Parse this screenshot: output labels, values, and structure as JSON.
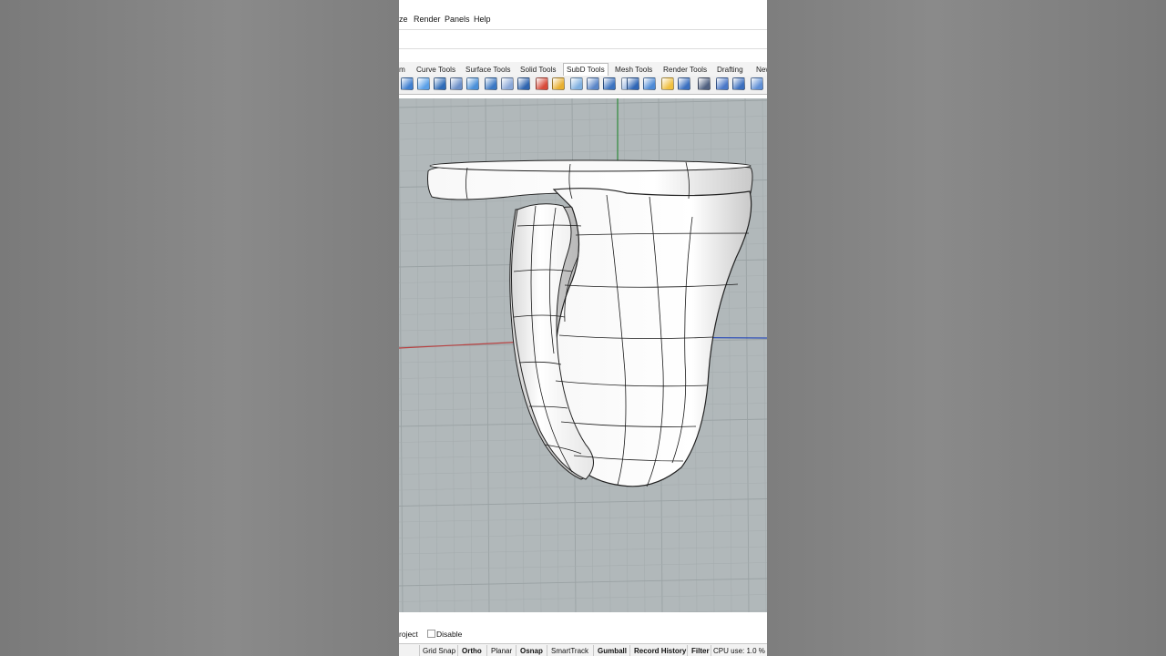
{
  "menu": {
    "items": [
      "ze",
      "Render",
      "Panels",
      "Help"
    ]
  },
  "tabs": [
    "m",
    "Curve Tools",
    "Surface Tools",
    "Solid Tools",
    "SubD Tools",
    "Mesh Tools",
    "Render Tools",
    "Drafting",
    "New"
  ],
  "active_tab": "SubD Tools",
  "toolbar_icons": [
    "subd-box-icon",
    "subd-sphere-icon",
    "subd-cylinder-icon",
    "subd-cone-icon",
    "subd-torus-icon",
    "subd-plane-icon",
    "subd-stretch-icon",
    "subd-bridge-icon",
    "subd-grid-icon",
    "subd-frame-icon",
    "subd-color-icon",
    "subd-crease-icon",
    "subd-weld-icon",
    "subd-fill-icon",
    "subd-star-icon",
    "subd-blob-icon",
    "subd-pipe-icon",
    "subd-loft-icon",
    "subd-edit-icon",
    "subd-tools-icon",
    "subd-move-icon",
    "subd-scale-icon"
  ],
  "options": {
    "project_label": "roject",
    "disable_label": "Disable"
  },
  "status": {
    "grid_snap": "Grid Snap",
    "ortho": "Ortho",
    "planar": "Planar",
    "osnap": "Osnap",
    "smarttrack": "SmartTrack",
    "gumball": "Gumball",
    "record_history": "Record History",
    "filter": "Filter",
    "cpu": "CPU use: 1.0 %"
  },
  "colors": {
    "viewport_bg": "#b1b8ba",
    "x_axis": "#b84040",
    "y_axis": "#2f8a3a",
    "z_axis": "#3050b8",
    "surface": "#f2f2f2"
  }
}
